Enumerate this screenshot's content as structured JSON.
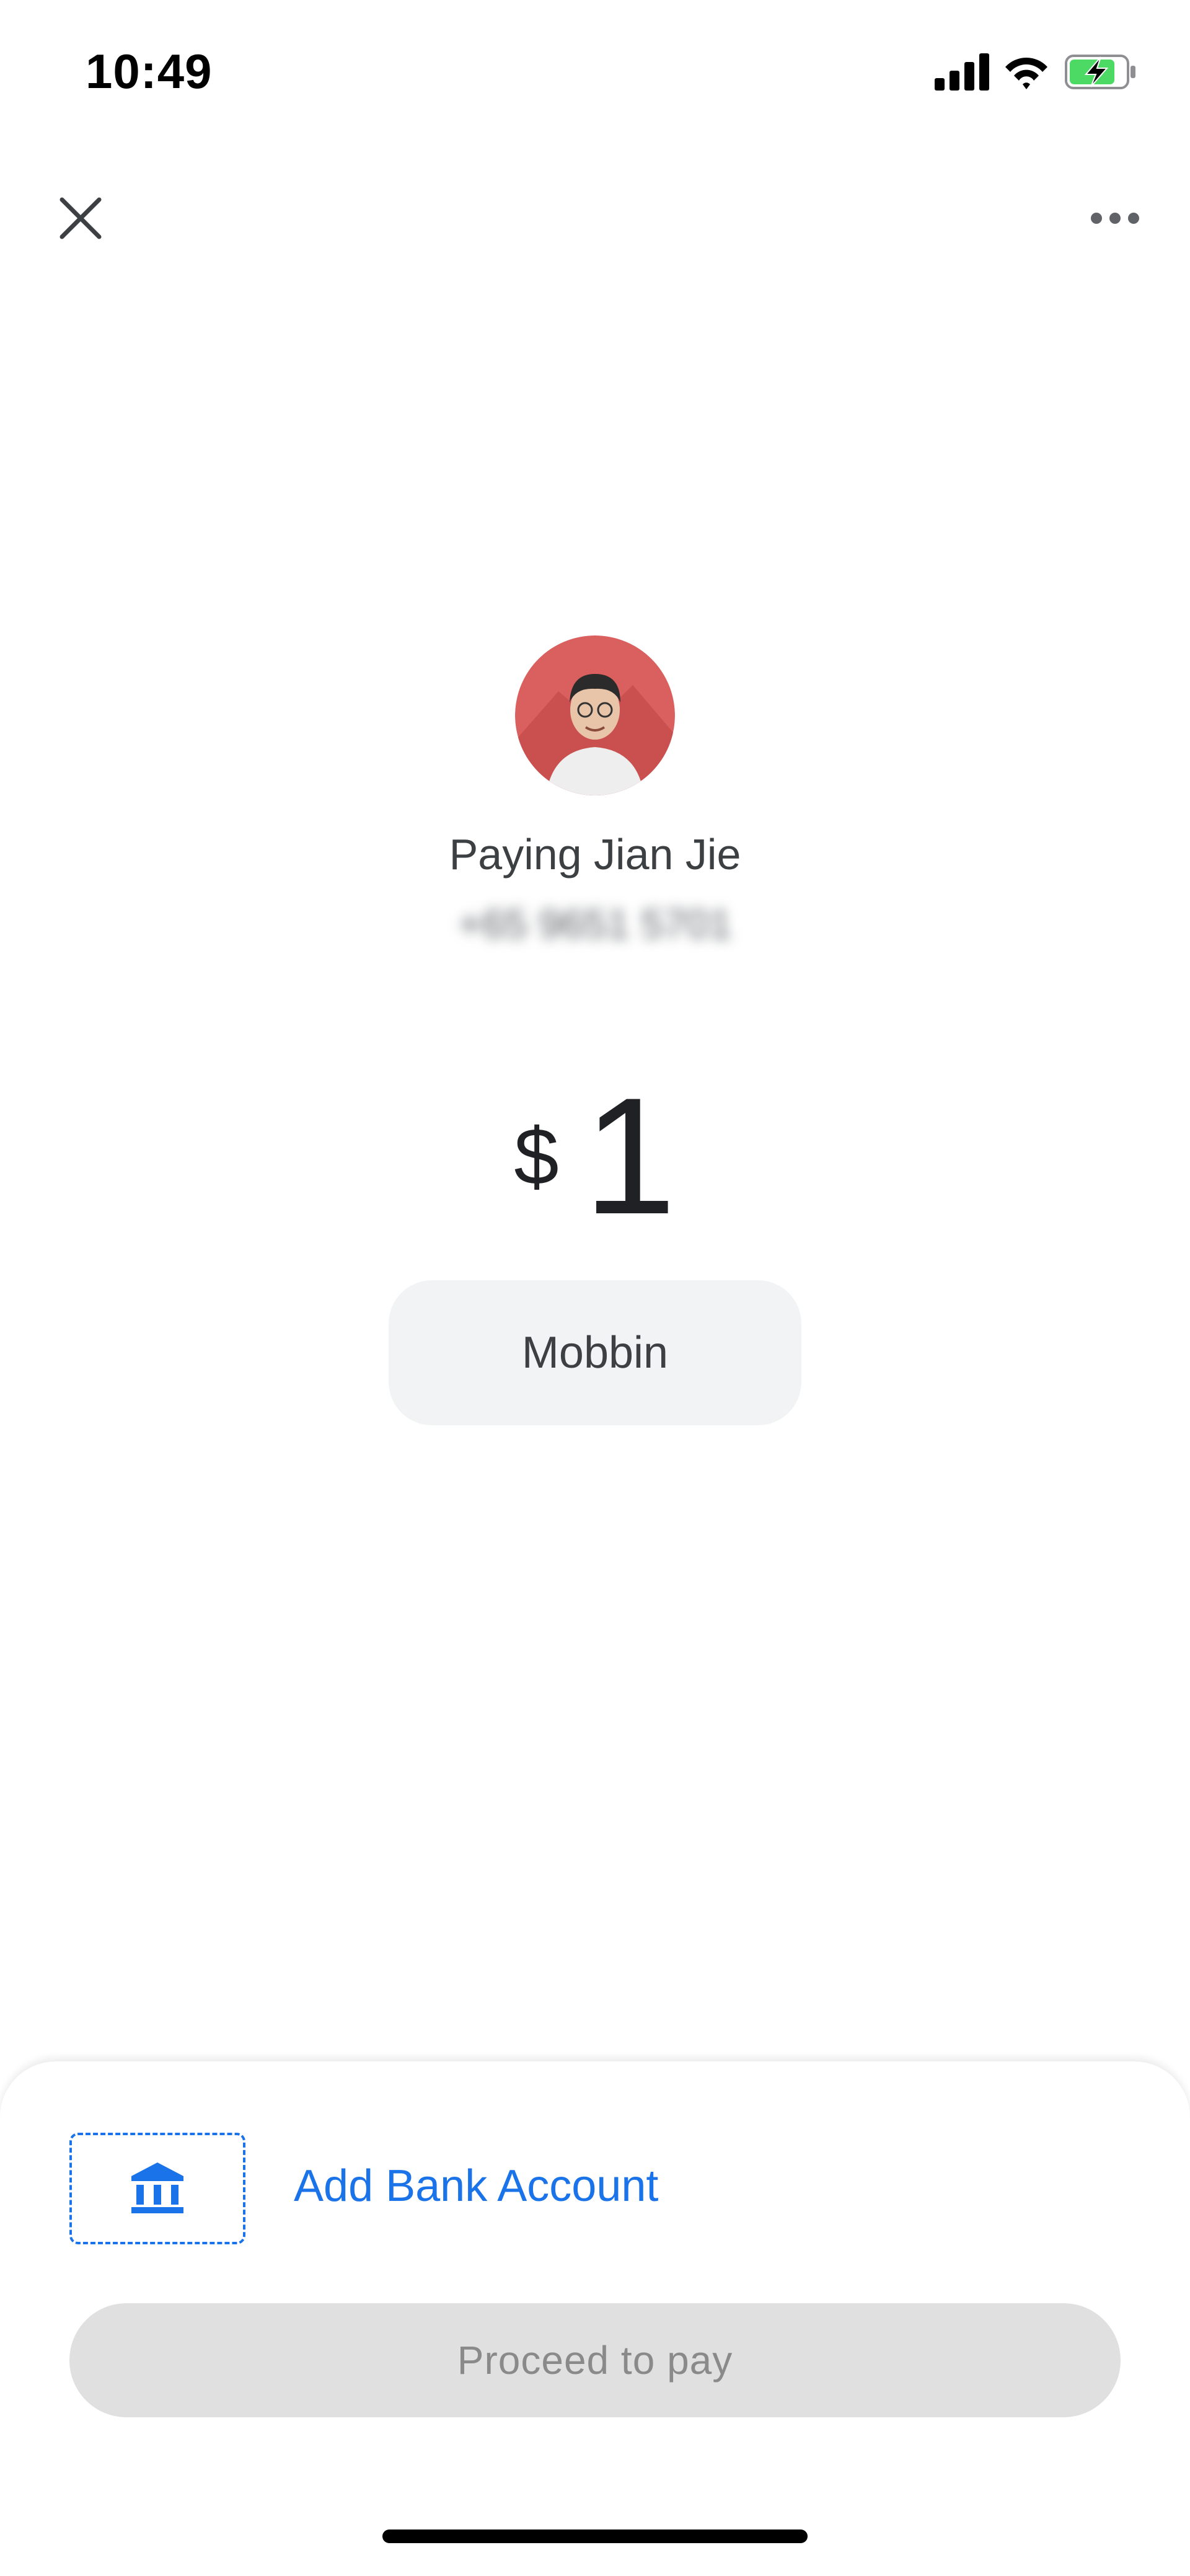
{
  "status_bar": {
    "time": "10:49",
    "icons": [
      "signal-icon",
      "wifi-icon",
      "battery-charging-icon"
    ],
    "battery_color": "#4cd964"
  },
  "toolbar": {
    "close_icon": "close-icon",
    "more_icon": "more-horizontal-icon"
  },
  "payee": {
    "title": "Paying Jian Jie",
    "phone": "+65 9651 5701",
    "avatar_bg": "#d9605f"
  },
  "amount": {
    "currency": "$",
    "value": "1"
  },
  "note": {
    "label": "Mobbin"
  },
  "payment_method": {
    "icon": "bank-icon",
    "label": "Add Bank Account",
    "accent": "#1a73e8"
  },
  "actions": {
    "proceed_label": "Proceed to pay",
    "proceed_enabled": false
  }
}
